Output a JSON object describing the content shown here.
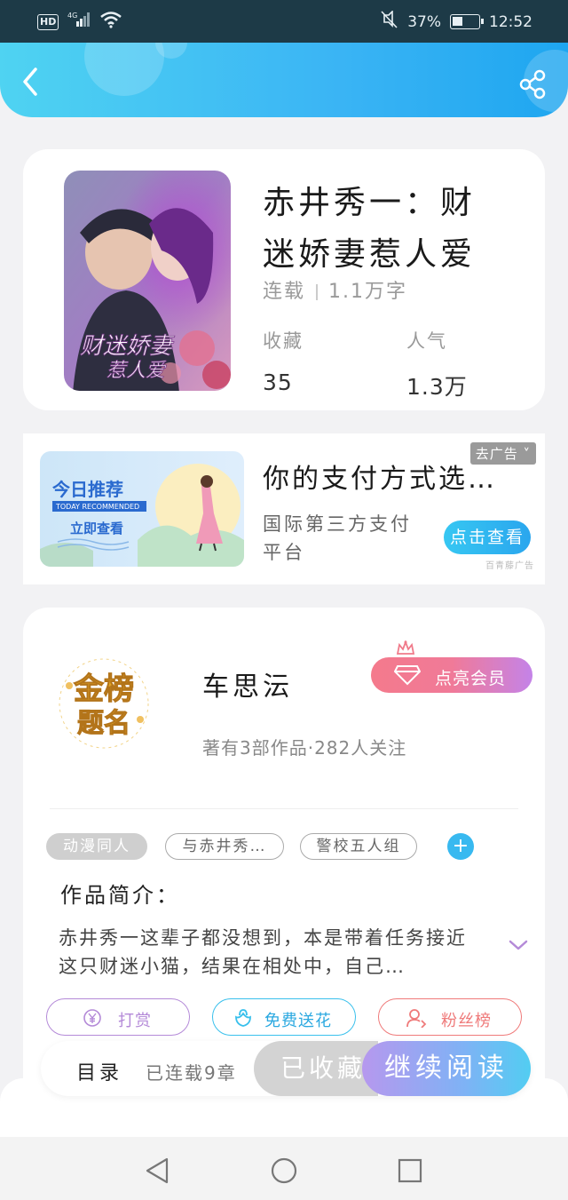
{
  "status_bar": {
    "hd": "HD",
    "network": "4G",
    "battery": "37%",
    "time": "12:52"
  },
  "header": {
    "back_icon": "chevron-left-icon",
    "share_icon": "share-icon"
  },
  "book": {
    "title": "赤井秀一：财迷娇妻惹人爱",
    "title_line1": "赤井秀一：财",
    "title_line2": "迷娇妻惹人爱",
    "status": "连载",
    "word_count": "1.1万字",
    "favorites_label": "收藏",
    "favorites_value": "35",
    "popularity_label": "人气",
    "popularity_value": "1.3万"
  },
  "ad": {
    "banner_title": "今日推荐",
    "banner_subtitle": "TODAY RECOMMENDED",
    "banner_cta": "立即查看",
    "title": "你的支付方式选…",
    "description": "国际第三方支付平台",
    "close_label": "去广告",
    "cta_label": "点击查看",
    "source": "百青藤广告"
  },
  "author": {
    "name": "车思沄",
    "stats": "著有3部作品·282人关注",
    "vip_label": "点亮会员",
    "avatar_text_line1": "金榜",
    "avatar_text_line2": "题名"
  },
  "tags": [
    "动漫同人",
    "与赤井秀…",
    "警校五人组"
  ],
  "intro": {
    "label": "作品简介：",
    "text": "赤井秀一这辈子都没想到，本是带着任务接近这只财迷小猫，结果在相处中，自己…"
  },
  "actions": {
    "reward": "打赏",
    "flowers": "免费送花",
    "fans": "粉丝榜"
  },
  "bottom_bar": {
    "toc": "目录",
    "chapters": "已连载9章",
    "collected": "已收藏",
    "continue": "继续阅读"
  },
  "colors": {
    "header_start": "#4fd3f2",
    "header_end": "#1ea6f0",
    "accent_blue": "#38b9f0",
    "vip_pink": "#f47a8c",
    "reward_purple": "#b48ad8",
    "flower_cyan": "#39c0ec",
    "fans_red": "#ef7a7a"
  }
}
